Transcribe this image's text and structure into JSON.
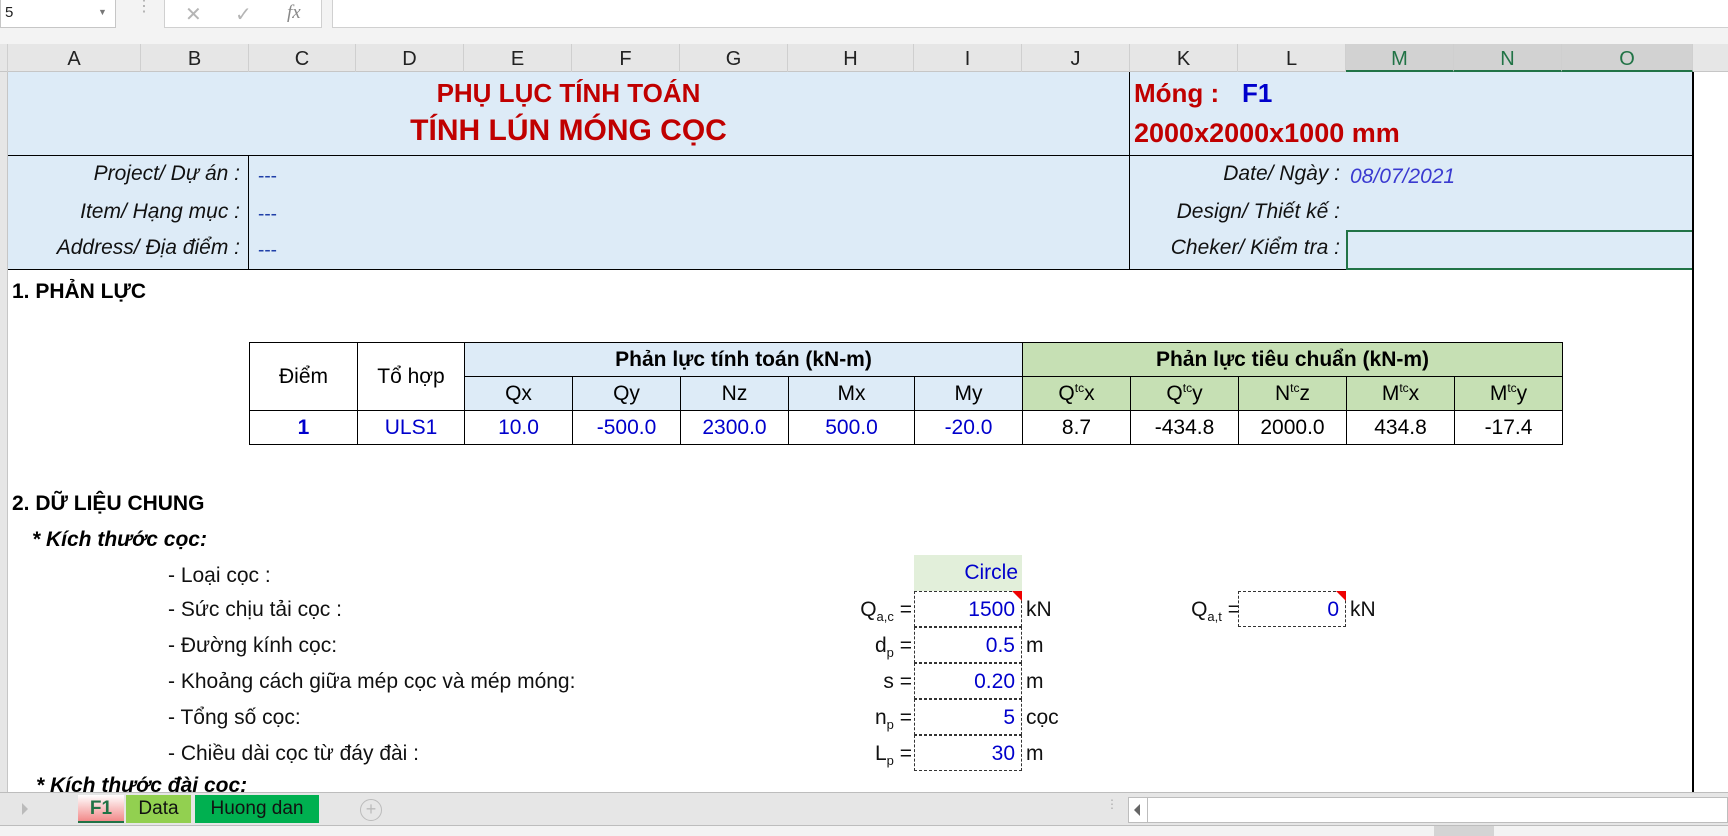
{
  "formula_bar": {
    "name_box": "5",
    "cancel_icon": "✕",
    "enter_icon": "✓",
    "fx_label": "fx",
    "formula": ""
  },
  "columns": [
    "A",
    "B",
    "C",
    "D",
    "E",
    "F",
    "G",
    "H",
    "I",
    "J",
    "K",
    "L",
    "M",
    "N",
    "O"
  ],
  "header": {
    "title1": "PHỤ LỤC TÍNH TOÁN",
    "title2": "TÍNH LÚN MÓNG CỌC",
    "foundation_label": "Móng :",
    "foundation_id": "F1",
    "dimensions": "2000x2000x1000 mm"
  },
  "info": {
    "project_label": "Project/ Dự án :",
    "project_value": "---",
    "item_label": "Item/ Hạng mục :",
    "item_value": "---",
    "address_label": "Address/ Địa điểm :",
    "address_value": "---",
    "date_label": "Date/ Ngày :",
    "date_value": "08/07/2021",
    "design_label": "Design/ Thiết kế :",
    "design_value": "",
    "checker_label": "Cheker/ Kiểm tra :",
    "checker_value": ""
  },
  "section1": {
    "title": "1. PHẢN LỰC",
    "table": {
      "col_point": "Điểm",
      "col_combo": "Tổ hợp",
      "group_design": "Phản lực tính toán (kN-m)",
      "group_standard": "Phản lực tiêu chuẩn (kN-m)",
      "design_headers": [
        "Qx",
        "Qy",
        "Nz",
        "Mx",
        "My"
      ],
      "standard_headers": [
        {
          "base": "Q",
          "sup": "tc",
          "sub": "x"
        },
        {
          "base": "Q",
          "sup": "tc",
          "sub": "y"
        },
        {
          "base": "N",
          "sup": "tc",
          "sub": "z"
        },
        {
          "base": "M",
          "sup": "tc",
          "sub": "x"
        },
        {
          "base": "M",
          "sup": "tc",
          "sub": "y"
        }
      ],
      "rows": [
        {
          "point": "1",
          "combo": "ULS1",
          "design": [
            "10.0",
            "-500.0",
            "2300.0",
            "500.0",
            "-20.0"
          ],
          "standard": [
            "8.7",
            "-434.8",
            "2000.0",
            "434.8",
            "-17.4"
          ]
        }
      ]
    }
  },
  "section2": {
    "title": "2. DỮ LIỆU CHUNG",
    "sub_pile": "* Kích thước cọc:",
    "sub_cap": "* Kích thước đài cọc:",
    "pile_type_label": "- Loại cọc :",
    "pile_type_value": "Circle",
    "params": [
      {
        "desc": "- Sức chịu tải cọc :",
        "sym": "Q",
        "sub": "a,c",
        "value": "1500",
        "unit": "kN",
        "comment": true
      },
      {
        "desc": "- Đường kính cọc:",
        "sym": "d",
        "sub": "p",
        "value": "0.5",
        "unit": "m",
        "comment": false
      },
      {
        "desc": "- Khoảng cách giữa mép cọc và mép móng:",
        "sym": "s",
        "sub": "",
        "value": "0.20",
        "unit": "m",
        "comment": false
      },
      {
        "desc": "- Tổng số cọc:",
        "sym": "n",
        "sub": "p",
        "value": "5",
        "unit": "cọc",
        "comment": false
      },
      {
        "desc": "- Chiều dài cọc từ đáy đài :",
        "sym": "L",
        "sub": "p",
        "value": "30",
        "unit": "m",
        "comment": false
      }
    ],
    "tension": {
      "sym": "Q",
      "sub": "a,t",
      "value": "0",
      "unit": "kN"
    }
  },
  "sheet_tabs": [
    "F1",
    "Data",
    "Huong dan"
  ],
  "active_tab": "F1",
  "colors": {
    "title_red": "#c00000",
    "input_blue": "#0000cc",
    "header_blue_bg": "#ddebf7",
    "header_green_bg": "#c6e0b4",
    "excel_green": "#217346"
  }
}
